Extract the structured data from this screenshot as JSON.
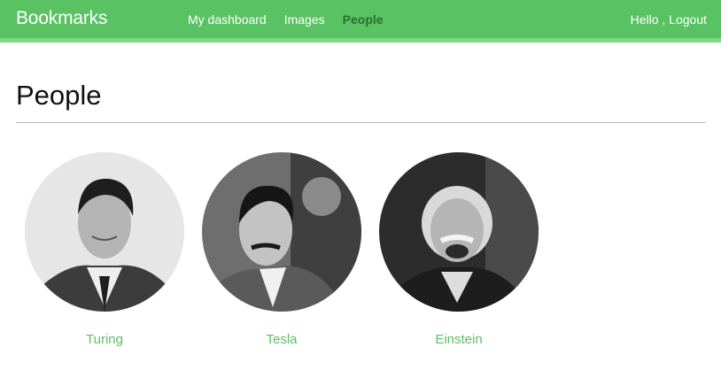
{
  "header": {
    "logo": "Bookmarks",
    "menu": [
      {
        "label": "My dashboard",
        "active": false
      },
      {
        "label": "Images",
        "active": false
      },
      {
        "label": "People",
        "active": true
      }
    ],
    "user": {
      "hello": "Hello ,",
      "logout": "Logout"
    }
  },
  "page": {
    "title": "People"
  },
  "people": [
    {
      "name": "Turing",
      "avatar": "person-photo"
    },
    {
      "name": "Tesla",
      "avatar": "person-photo"
    },
    {
      "name": "Einstein",
      "avatar": "person-photo"
    }
  ],
  "colors": {
    "header_bg": "#59c263",
    "header_border": "#7ed67f",
    "active_menu": "#2d6e2f",
    "link": "#59c263"
  }
}
